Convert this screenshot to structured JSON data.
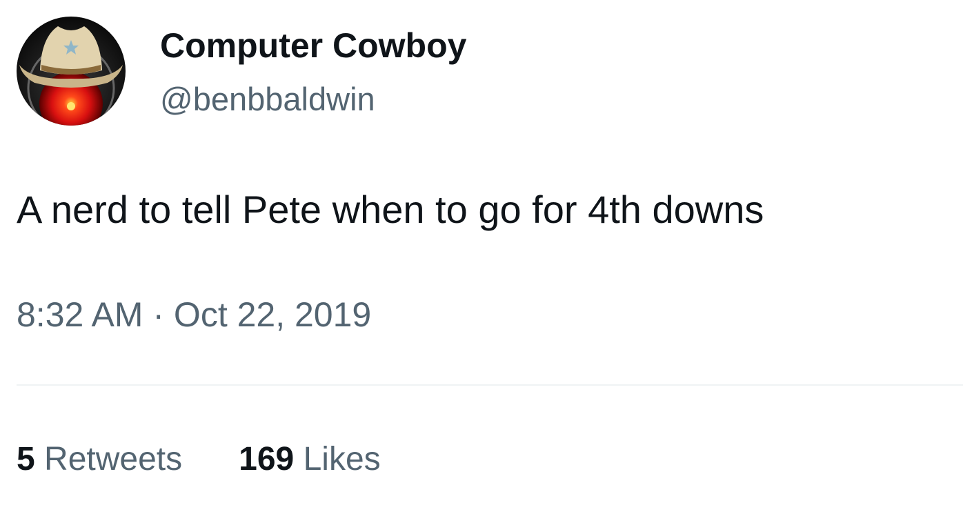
{
  "tweet": {
    "author": {
      "name": "Computer Cowboy",
      "handle": "@benbbaldwin",
      "avatar_icon": "cowboy-hat-red-eye-avatar"
    },
    "text": "A nerd to tell Pete when to go for 4th downs",
    "timestamp": {
      "time": "8:32 AM",
      "separator": "·",
      "date": "Oct 22, 2019"
    },
    "stats": {
      "retweets_count": "5",
      "retweets_label": "Retweets",
      "likes_count": "169",
      "likes_label": "Likes"
    }
  },
  "colors": {
    "text_primary": "#0f1419",
    "text_secondary": "#536471",
    "divider": "#eff3f4",
    "background": "#ffffff"
  }
}
